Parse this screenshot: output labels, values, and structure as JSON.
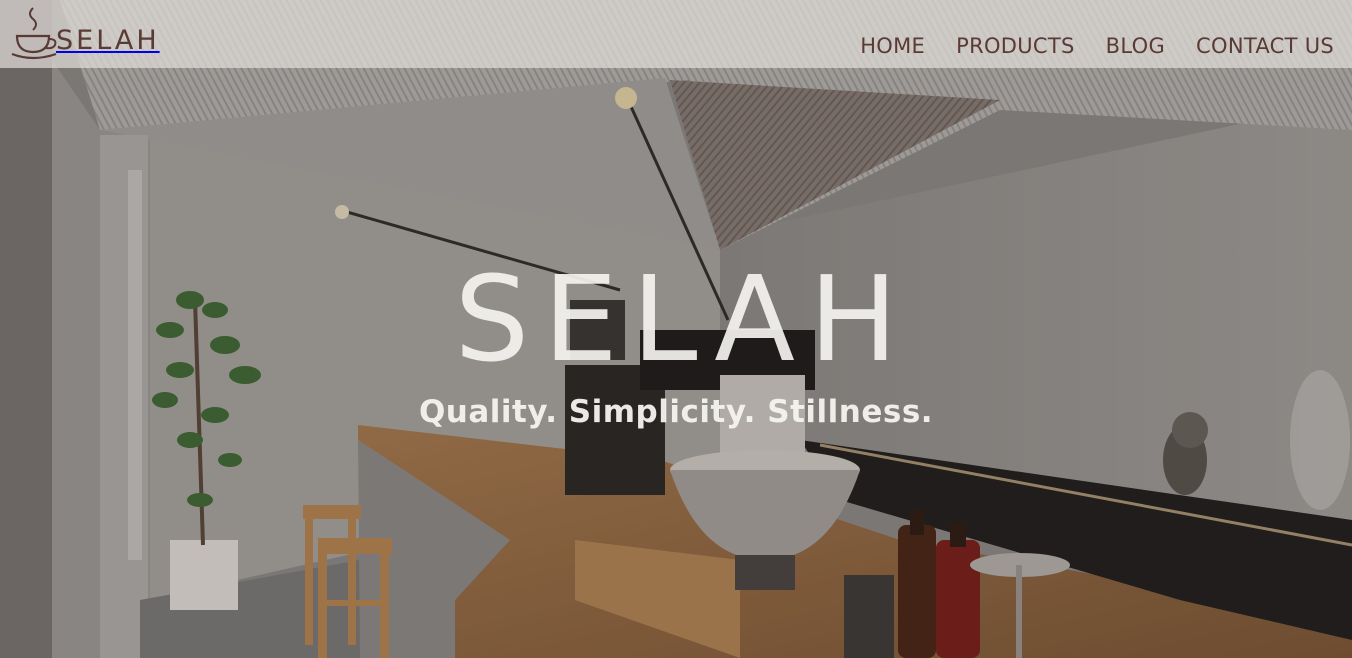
{
  "brand": {
    "logo_text": "SELAH",
    "logo_icon": "coffee-cup-icon"
  },
  "nav": {
    "items": [
      {
        "label": "HOME"
      },
      {
        "label": "PRODUCTS"
      },
      {
        "label": "BLOG"
      },
      {
        "label": "CONTACT US"
      }
    ]
  },
  "hero": {
    "title": "SELAH",
    "tagline": "Quality. Simplicity. Stillness.",
    "image": "cafe-interior-photo"
  },
  "colors": {
    "brand": "#5a3a34",
    "header_bg": "#e0dcd8",
    "hero_text": "#f5f3f0"
  }
}
